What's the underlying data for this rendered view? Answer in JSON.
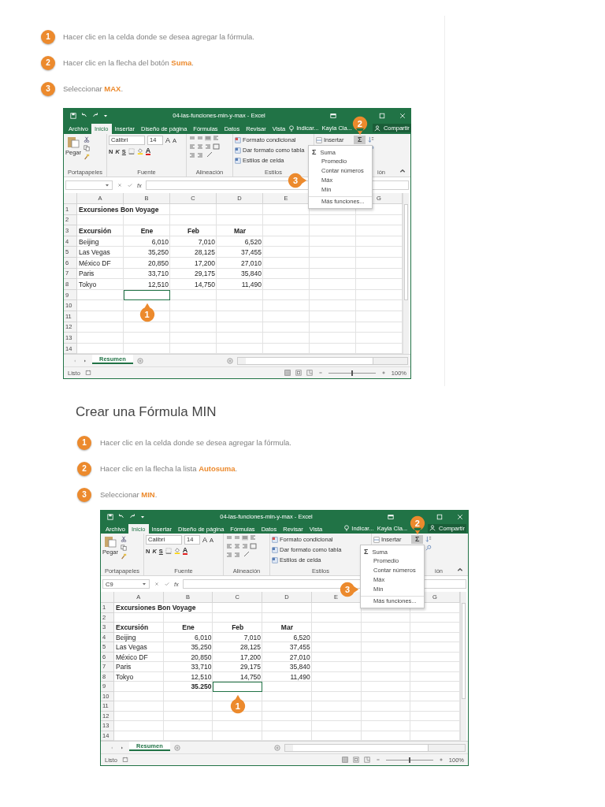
{
  "sections": [
    {
      "steps": [
        {
          "number": "1",
          "text": "Hacer clic en la celda donde se desea agregar la fórmula."
        },
        {
          "number": "2",
          "text": "Hacer clic en la flecha del botón **Suma**."
        },
        {
          "number": "3",
          "text": "Seleccionar **MAX**."
        }
      ],
      "excel": {
        "title": "04-las-funciones-min-y-max - Excel",
        "tabs": [
          {
            "label": "Archivo",
            "selected": false
          },
          {
            "label": "Inicio",
            "selected": true
          },
          {
            "label": "Insertar",
            "selected": false
          },
          {
            "label": "Diseño de página",
            "selected": false
          },
          {
            "label": "Fórmulas",
            "selected": false
          },
          {
            "label": "Datos",
            "selected": false
          },
          {
            "label": "Revisar",
            "selected": false
          },
          {
            "label": "Vista",
            "selected": false
          }
        ],
        "tell_me": "Indicar...",
        "user": "Kayla Cla...",
        "share": "Compartir",
        "paste": "Pegar",
        "font": "Calibri",
        "font_size": "14",
        "grow": "A",
        "shrink": "A",
        "format_buttons": [
          "N",
          "K",
          "S"
        ],
        "font_color": "A",
        "styles": [
          "Formato condicional",
          "Dar formato como tabla",
          "Estilos de celda"
        ],
        "insert": "Insertar",
        "sum": "Σ",
        "sum_callout": "2",
        "group_labels": [
          "Portapapeles",
          "Fuente",
          "Alineación",
          "Estilos",
          "ión"
        ],
        "menu": [
          {
            "kind": "sum",
            "symbol": "Σ",
            "label": "Suma"
          },
          {
            "kind": "item",
            "label": "Promedio"
          },
          {
            "kind": "item",
            "label": "Contar números"
          },
          {
            "kind": "item",
            "label": "Máx",
            "callout": "3"
          },
          {
            "kind": "item",
            "label": "Mín"
          },
          {
            "kind": "more",
            "label": "Más funciones..."
          }
        ],
        "fx": "fx",
        "columns": [
          {
            "label": "A"
          },
          {
            "label": "B"
          },
          {
            "label": "C"
          },
          {
            "label": "D"
          },
          {
            "label": "E"
          },
          {},
          {
            "label": "G"
          }
        ],
        "rows": [
          {
            "number": "1",
            "cells": [
              {
                "text": "Excursiones Bon Voyage",
                "kind": "text",
                "bold": true
              }
            ]
          },
          {
            "number": "2",
            "cells": []
          },
          {
            "number": "3",
            "cells": [
              {
                "text": "Excursión",
                "kind": "text",
                "bold": true
              },
              {
                "text": "Ene",
                "kind": "header",
                "bold": true
              },
              {
                "text": "Feb",
                "kind": "header",
                "bold": true
              },
              {
                "text": "Mar",
                "kind": "header",
                "bold": true
              }
            ]
          },
          {
            "number": "4",
            "cells": [
              {
                "text": "Beijing",
                "kind": "text"
              },
              {
                "text": "6,010",
                "kind": "number"
              },
              {
                "text": "7,010",
                "kind": "number"
              },
              {
                "text": "6,520",
                "kind": "number"
              }
            ]
          },
          {
            "number": "5",
            "cells": [
              {
                "text": "Las Vegas",
                "kind": "text"
              },
              {
                "text": "35,250",
                "kind": "number"
              },
              {
                "text": "28,125",
                "kind": "number"
              },
              {
                "text": "37,455",
                "kind": "number"
              }
            ]
          },
          {
            "number": "6",
            "cells": [
              {
                "text": "México DF",
                "kind": "text"
              },
              {
                "text": "20,850",
                "kind": "number"
              },
              {
                "text": "17,200",
                "kind": "number"
              },
              {
                "text": "27,010",
                "kind": "number"
              }
            ]
          },
          {
            "number": "7",
            "cells": [
              {
                "text": "Paris",
                "kind": "text"
              },
              {
                "text": "33,710",
                "kind": "number"
              },
              {
                "text": "29,175",
                "kind": "number"
              },
              {
                "text": "35,840",
                "kind": "number"
              }
            ]
          },
          {
            "number": "8",
            "cells": [
              {
                "text": "Tokyo",
                "kind": "text"
              },
              {
                "text": "12,510",
                "kind": "number"
              },
              {
                "text": "14,750",
                "kind": "number"
              },
              {
                "text": "11,490",
                "kind": "number"
              }
            ]
          },
          {
            "number": "9",
            "cells": [
              {},
              {
                "selected": true,
                "callout": "1"
              }
            ]
          },
          {
            "number": "10",
            "cells": []
          },
          {
            "number": "11",
            "cells": []
          },
          {
            "number": "12",
            "cells": []
          },
          {
            "number": "13",
            "cells": []
          },
          {
            "number": "14",
            "cells": []
          }
        ],
        "sheet_tab": {
          "label": "Resumen",
          "selected": true
        },
        "status": "Listo",
        "zoom": {
          "level": 0.5
        },
        "zoom_label": "100%"
      }
    },
    {
      "heading": "Crear una Fórmula MIN",
      "steps": [
        {
          "number": "1",
          "text": "Hacer clic en la celda donde se desea agregar la fórmula."
        },
        {
          "number": "2",
          "text": "Hacer clic en la flecha la lista **Autosuma**."
        },
        {
          "number": "3",
          "text": "Seleccionar **MIN**."
        }
      ],
      "excel": {
        "title": "04-las-funciones-min-y-max - Excel",
        "tabs": [
          {
            "label": "Archivo",
            "selected": false
          },
          {
            "label": "Inicio",
            "selected": true
          },
          {
            "label": "Insertar",
            "selected": false
          },
          {
            "label": "Diseño de página",
            "selected": false
          },
          {
            "label": "Fórmulas",
            "selected": false
          },
          {
            "label": "Datos",
            "selected": false
          },
          {
            "label": "Revisar",
            "selected": false
          },
          {
            "label": "Vista",
            "selected": false
          }
        ],
        "tell_me": "Indicar...",
        "user": "Kayla Cla...",
        "share": "Compartir",
        "paste": "Pegar",
        "font": "Calibri",
        "font_size": "14",
        "grow": "A",
        "shrink": "A",
        "format_buttons": [
          "N",
          "K",
          "S"
        ],
        "font_color": "A",
        "styles": [
          "Formato condicional",
          "Dar formato como tabla",
          "Estilos de celda"
        ],
        "insert": "Insertar",
        "sum": "Σ",
        "sum_callout": "2",
        "group_labels": [
          "Portapapeles",
          "Fuente",
          "Alineación",
          "Estilos",
          "ión"
        ],
        "menu": [
          {
            "kind": "sum",
            "symbol": "Σ",
            "label": "Suma"
          },
          {
            "kind": "item",
            "label": "Promedio"
          },
          {
            "kind": "item",
            "label": "Contar números"
          },
          {
            "kind": "item",
            "label": "Máx"
          },
          {
            "kind": "item",
            "label": "Mín",
            "callout": "3"
          },
          {
            "kind": "more",
            "label": "Más funciones..."
          }
        ],
        "name_box": "C9",
        "fx": "fx",
        "columns": [
          {
            "label": "A"
          },
          {
            "label": "B"
          },
          {
            "label": "C"
          },
          {
            "label": "D"
          },
          {
            "label": "E"
          },
          {},
          {
            "label": "G"
          }
        ],
        "rows": [
          {
            "number": "1",
            "cells": [
              {
                "text": "Excursiones Bon Voyage",
                "kind": "text",
                "bold": true
              }
            ]
          },
          {
            "number": "2",
            "cells": []
          },
          {
            "number": "3",
            "cells": [
              {
                "text": "Excursión",
                "kind": "text",
                "bold": true
              },
              {
                "text": "Ene",
                "kind": "header",
                "bold": true
              },
              {
                "text": "Feb",
                "kind": "header",
                "bold": true
              },
              {
                "text": "Mar",
                "kind": "header",
                "bold": true
              }
            ]
          },
          {
            "number": "4",
            "cells": [
              {
                "text": "Beijing",
                "kind": "text"
              },
              {
                "text": "6,010",
                "kind": "number"
              },
              {
                "text": "7,010",
                "kind": "number"
              },
              {
                "text": "6,520",
                "kind": "number"
              }
            ]
          },
          {
            "number": "5",
            "cells": [
              {
                "text": "Las Vegas",
                "kind": "text"
              },
              {
                "text": "35,250",
                "kind": "number"
              },
              {
                "text": "28,125",
                "kind": "number"
              },
              {
                "text": "37,455",
                "kind": "number"
              }
            ]
          },
          {
            "number": "6",
            "cells": [
              {
                "text": "México DF",
                "kind": "text"
              },
              {
                "text": "20,850",
                "kind": "number"
              },
              {
                "text": "17,200",
                "kind": "number"
              },
              {
                "text": "27,010",
                "kind": "number"
              }
            ]
          },
          {
            "number": "7",
            "cells": [
              {
                "text": "Paris",
                "kind": "text"
              },
              {
                "text": "33,710",
                "kind": "number"
              },
              {
                "text": "29,175",
                "kind": "number"
              },
              {
                "text": "35,840",
                "kind": "number"
              }
            ]
          },
          {
            "number": "8",
            "cells": [
              {
                "text": "Tokyo",
                "kind": "text"
              },
              {
                "text": "12,510",
                "kind": "number"
              },
              {
                "text": "14,750",
                "kind": "number"
              },
              {
                "text": "11,490",
                "kind": "number"
              }
            ]
          },
          {
            "number": "9",
            "cells": [
              {},
              {
                "text": "35.250",
                "kind": "number",
                "bold": true
              },
              {
                "selected": true,
                "callout": "1"
              }
            ]
          },
          {
            "number": "10",
            "cells": []
          },
          {
            "number": "11",
            "cells": []
          },
          {
            "number": "12",
            "cells": []
          },
          {
            "number": "13",
            "cells": []
          },
          {
            "number": "14",
            "cells": []
          }
        ],
        "sheet_tab": {
          "label": "Resumen",
          "selected": true
        },
        "status": "Listo",
        "zoom": {
          "level": 0.5
        },
        "zoom_label": "100%"
      }
    }
  ]
}
